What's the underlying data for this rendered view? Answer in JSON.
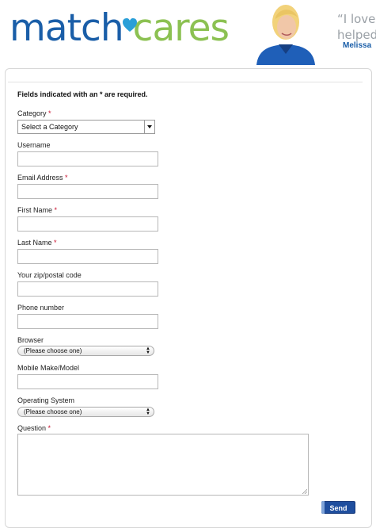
{
  "header": {
    "logo_match": "match",
    "logo_cares": "cares",
    "quote_line1": "“I love l",
    "quote_line2": "helped",
    "quote_name": "Melissa"
  },
  "form": {
    "required_note": "Fields indicated with an * are required.",
    "required_mark": "*",
    "category_label": "Category",
    "category_value": "Select a Category",
    "username_label": "Username",
    "email_label": "Email Address",
    "first_name_label": "First Name",
    "last_name_label": "Last Name",
    "zip_label": "Your zip/postal code",
    "phone_label": "Phone number",
    "browser_label": "Browser",
    "browser_value": "(Please choose one)",
    "mobile_label": "Mobile Make/Model",
    "os_label": "Operating System",
    "os_value": "(Please choose one)",
    "question_label": "Question",
    "send_label": "Send"
  },
  "colors": {
    "brand_blue": "#1a5ea8",
    "brand_green": "#8cc152",
    "required_red": "#c8102e",
    "button_blue": "#1f4e9e"
  }
}
